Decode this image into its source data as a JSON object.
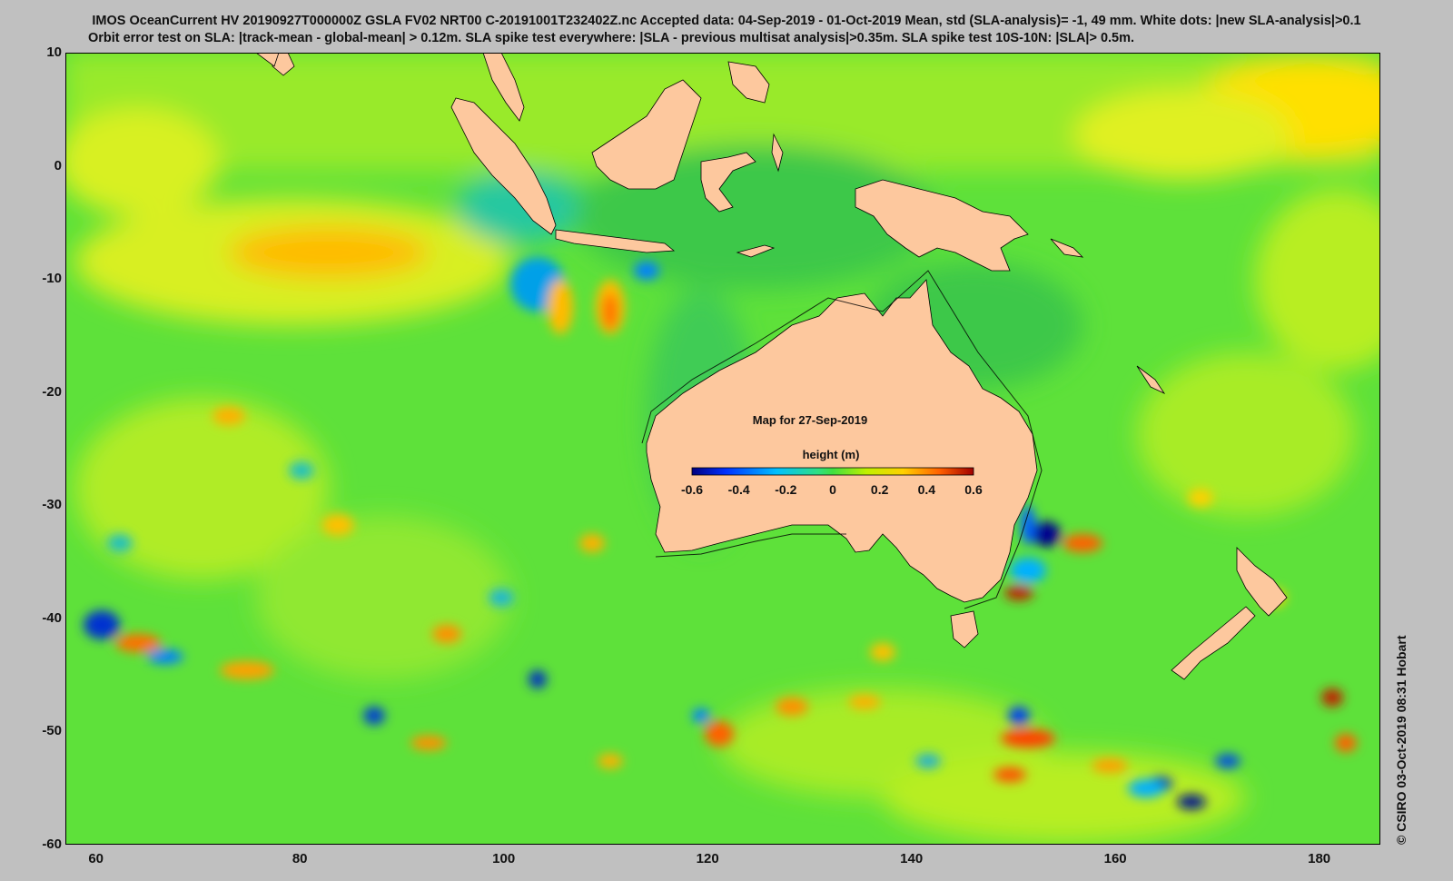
{
  "header": {
    "line1": "IMOS OceanCurrent HV 20190927T000000Z GSLA FV02 NRT00 C-20191001T232402Z.nc  Accepted data: 04-Sep-2019 - 01-Oct-2019 Mean, std (SLA-analysis)= -1, 49 mm. White dots: |new SLA-analysis|>0.1",
    "line2": "Orbit error test on SLA: |track-mean  - global-mean| > 0.12m.  SLA spike test everywhere: |SLA - previous multisat analysis|>0.35m. SLA spike test 10S-10N: |SLA|> 0.5m."
  },
  "map": {
    "date_label": "Map for 27-Sep-2019",
    "colorbar_title": "height (m)",
    "colorbar_ticks": [
      "-0.6",
      "-0.4",
      "-0.2",
      "0",
      "0.2",
      "0.4",
      "0.6"
    ],
    "colorbar_range": [
      -0.6,
      0.6
    ],
    "lon_range": [
      57,
      186
    ],
    "lat_range": [
      -60,
      10
    ],
    "lon_ticks": [
      "60",
      "80",
      "100",
      "120",
      "140",
      "160",
      "180"
    ],
    "lat_ticks": [
      "10",
      "0",
      "-10",
      "-20",
      "-30",
      "-40",
      "-50",
      "-60"
    ],
    "land_color": "#fdc89e",
    "ocean_base_color": "#5ee13a"
  },
  "credit": "© CSIRO 03-Oct-2019 08:31 Hobart"
}
